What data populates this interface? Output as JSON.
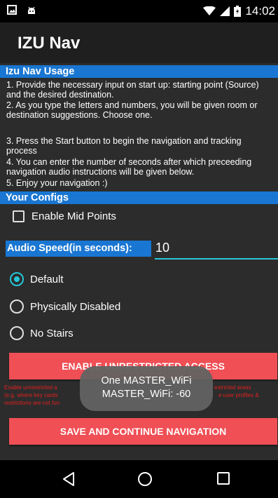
{
  "status_bar": {
    "time": "14:02",
    "icons": [
      "notification-image-icon",
      "android-icon",
      "wifi-icon",
      "signal-icon",
      "battery-icon"
    ]
  },
  "app": {
    "title": "IZU Nav"
  },
  "usage": {
    "header": "Izu Nav Usage",
    "lines": [
      "1. Provide the necessary input on start up: starting point (Source)",
      "and   the desired destination.",
      " 2. As you type the letters and numbers, you will be given room or",
      "destination suggestions. Choose one.",
      "",
      " 3. Press the Start button to begin the navigation and tracking",
      "process",
      " 4. You can enter the number of seconds after which preceeding",
      "navigation audio instructions will be given below.",
      " 5. Enjoy your navigation :)"
    ]
  },
  "configs": {
    "header": "Your Configs",
    "mid_points_label": "Enable Mid Points",
    "mid_points_checked": false,
    "audio_speed_label": "Audio Speed(in seconds):",
    "audio_speed_value": "10",
    "options": [
      {
        "label": "Default",
        "checked": true
      },
      {
        "label": "Physically Disabled",
        "checked": false
      },
      {
        "label": "No Stairs",
        "checked": false
      }
    ]
  },
  "buttons": {
    "unrestricted": "ENABLE UNRESTRICTED ACCESS",
    "save": "SAVE AND CONTINUE NAVIGATION"
  },
  "warning": {
    "line1_left": "Enable unrestricted a",
    "line1_right": "estricted areas",
    "line2_left": "(e.g. where key cards",
    "line2_right": "e user profiles &",
    "line3_left": "restrictions are not fun"
  },
  "toast": {
    "line1": "One MASTER_WiFi",
    "line2": "MASTER_WiFi: -60"
  },
  "colors": {
    "accent": "#1976d2",
    "button": "#ef4f55",
    "radio_active": "#26c6da",
    "warning_text": "#e02020"
  }
}
